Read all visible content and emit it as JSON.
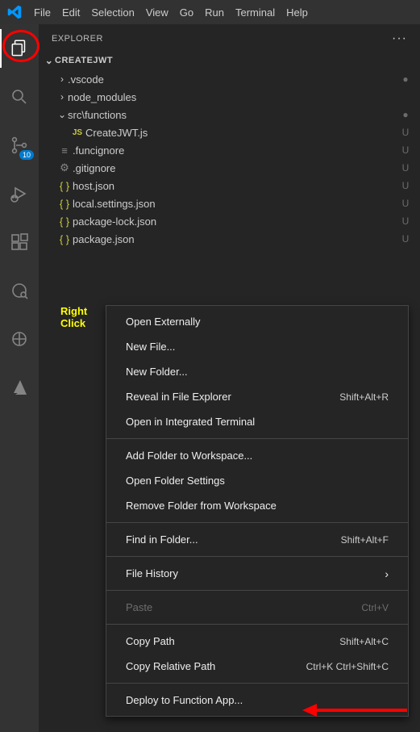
{
  "menubar": [
    "File",
    "Edit",
    "Selection",
    "View",
    "Go",
    "Run",
    "Terminal",
    "Help"
  ],
  "activitybar": {
    "items": [
      {
        "name": "explorer-icon"
      },
      {
        "name": "search-icon"
      },
      {
        "name": "source-control-icon",
        "badge": "10"
      },
      {
        "name": "run-debug-icon"
      },
      {
        "name": "extensions-icon"
      },
      {
        "name": "remote-explorer-icon"
      },
      {
        "name": "docker-icon"
      },
      {
        "name": "azure-icon"
      }
    ]
  },
  "explorer": {
    "title": "EXPLORER",
    "root": "CREATEJWT",
    "tree": [
      {
        "type": "folder",
        "label": ".vscode",
        "decoration": "●",
        "indent": 1,
        "expanded": false
      },
      {
        "type": "folder",
        "label": "node_modules",
        "decoration": "",
        "indent": 1,
        "expanded": false
      },
      {
        "type": "folder",
        "label": "src\\functions",
        "decoration": "●",
        "indent": 1,
        "expanded": true
      },
      {
        "type": "file",
        "label": "CreateJWT.js",
        "decoration": "U",
        "indent": 2,
        "icon": "js"
      },
      {
        "type": "file",
        "label": ".funcignore",
        "decoration": "U",
        "indent": 1,
        "icon": "lines"
      },
      {
        "type": "file",
        "label": ".gitignore",
        "decoration": "U",
        "indent": 1,
        "icon": "gear"
      },
      {
        "type": "file",
        "label": "host.json",
        "decoration": "U",
        "indent": 1,
        "icon": "braces"
      },
      {
        "type": "file",
        "label": "local.settings.json",
        "decoration": "U",
        "indent": 1,
        "icon": "braces"
      },
      {
        "type": "file",
        "label": "package-lock.json",
        "decoration": "U",
        "indent": 1,
        "icon": "braces"
      },
      {
        "type": "file",
        "label": "package.json",
        "decoration": "U",
        "indent": 1,
        "icon": "braces"
      }
    ]
  },
  "annotation": {
    "rightclick_line1": "Right",
    "rightclick_line2": "Click"
  },
  "context_menu": {
    "groups": [
      [
        {
          "label": "Open Externally",
          "shortcut": ""
        },
        {
          "label": "New File...",
          "shortcut": ""
        },
        {
          "label": "New Folder...",
          "shortcut": ""
        },
        {
          "label": "Reveal in File Explorer",
          "shortcut": "Shift+Alt+R"
        },
        {
          "label": "Open in Integrated Terminal",
          "shortcut": ""
        }
      ],
      [
        {
          "label": "Add Folder to Workspace...",
          "shortcut": ""
        },
        {
          "label": "Open Folder Settings",
          "shortcut": ""
        },
        {
          "label": "Remove Folder from Workspace",
          "shortcut": ""
        }
      ],
      [
        {
          "label": "Find in Folder...",
          "shortcut": "Shift+Alt+F"
        }
      ],
      [
        {
          "label": "File History",
          "shortcut": "",
          "submenu": true
        }
      ],
      [
        {
          "label": "Paste",
          "shortcut": "Ctrl+V",
          "disabled": true
        }
      ],
      [
        {
          "label": "Copy Path",
          "shortcut": "Shift+Alt+C"
        },
        {
          "label": "Copy Relative Path",
          "shortcut": "Ctrl+K Ctrl+Shift+C"
        }
      ],
      [
        {
          "label": "Deploy to Function App...",
          "shortcut": ""
        }
      ]
    ]
  }
}
